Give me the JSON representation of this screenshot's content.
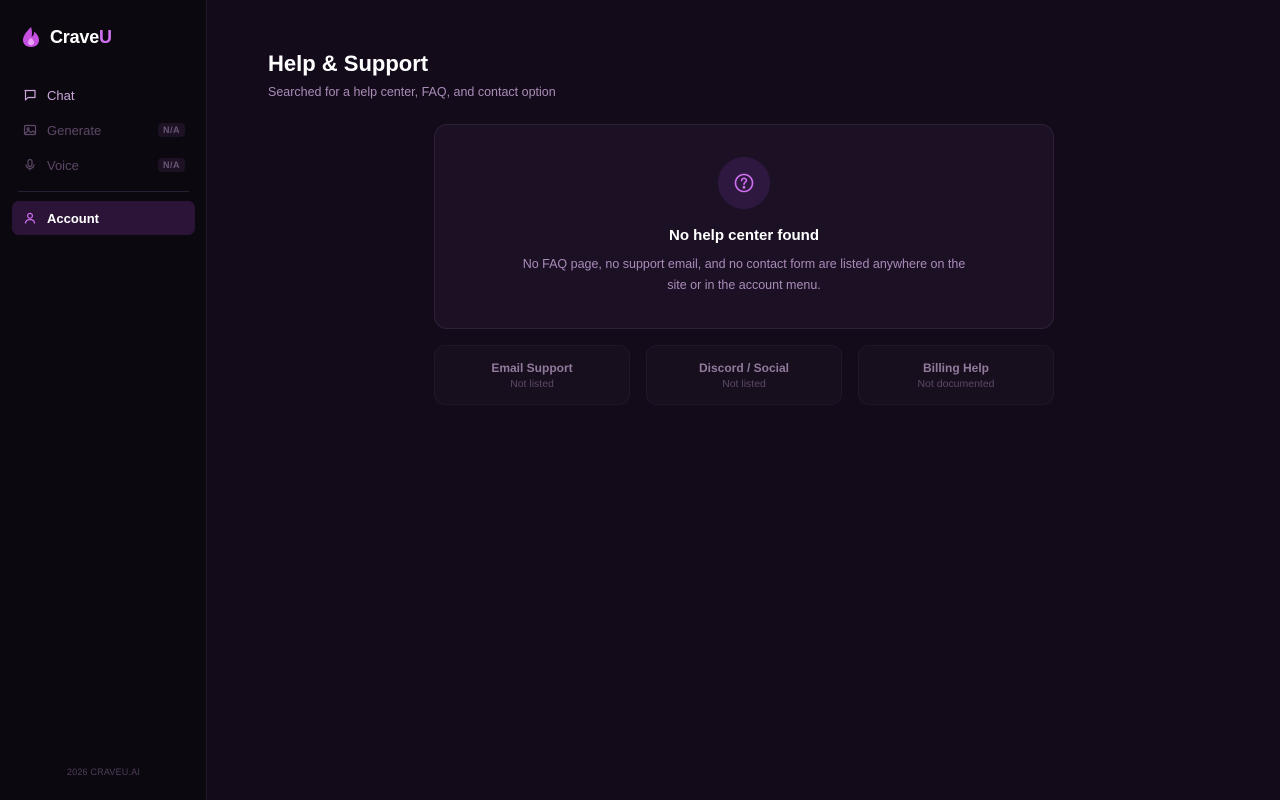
{
  "brand": {
    "name_main": "Crave",
    "name_accent": "U",
    "accent_color": "#d070f0"
  },
  "sidebar": {
    "items": [
      {
        "label": "Chat",
        "icon": "chat-icon",
        "badge": null
      },
      {
        "label": "Generate",
        "icon": "image-icon",
        "badge": "N/A"
      },
      {
        "label": "Voice",
        "icon": "microphone-icon",
        "badge": "N/A"
      },
      {
        "label": "Account",
        "icon": "user-icon",
        "badge": null,
        "active": true
      }
    ],
    "footer": "2026 CRAVEU.AI"
  },
  "main": {
    "title": "Help & Support",
    "subtitle": "Searched for a help center, FAQ, and contact option",
    "card": {
      "icon": "help-circle-icon",
      "title": "No help center found",
      "description": "No FAQ page, no support email, and no contact form are listed anywhere on the site or in the account menu."
    },
    "options": [
      {
        "title": "Email Support",
        "status": "Not listed"
      },
      {
        "title": "Discord / Social",
        "status": "Not listed"
      },
      {
        "title": "Billing Help",
        "status": "Not documented"
      }
    ]
  },
  "colors": {
    "background": "#140b1a",
    "sidebar": "#0c0810",
    "active_item": "#2c1438",
    "accent": "#d070f0"
  }
}
